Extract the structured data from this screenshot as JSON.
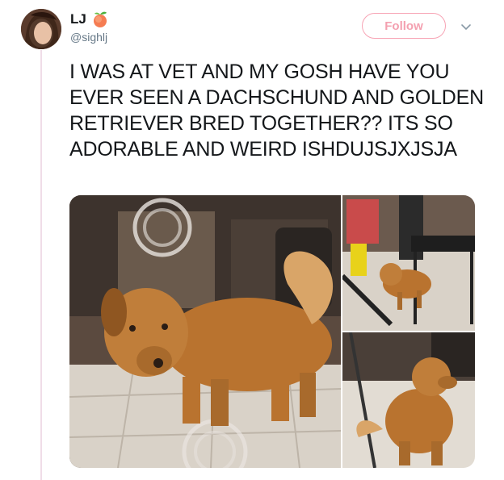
{
  "tweet": {
    "display_name": "LJ",
    "name_emoji": "peach-icon",
    "handle": "@sighlj",
    "follow_label": "Follow",
    "text": "I WAS AT VET AND MY GOSH HAVE YOU EVER SEEN A DACHSCHUND AND GOLDEN RETRIEVER BRED TOGETHER?? ITS SO ADORABLE AND WEIRD ISHDUJSJXJSJA"
  },
  "colors": {
    "accent": "#f4a0b0",
    "thread_line": "#f0dde8",
    "text": "#14171a",
    "handle": "#657786",
    "dog_fur": "#b9732f"
  }
}
